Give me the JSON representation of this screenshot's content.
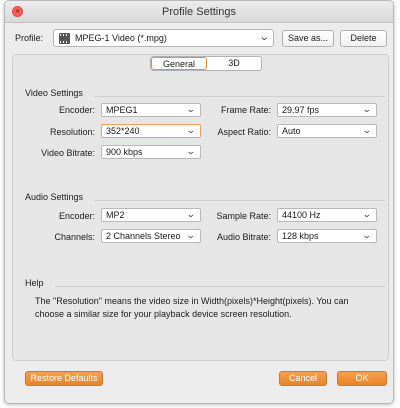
{
  "window": {
    "title": "Profile Settings"
  },
  "profile": {
    "label": "Profile:",
    "value": "MPEG-1 Video (*.mpg)",
    "save_as": "Save as...",
    "delete": "Delete"
  },
  "tabs": [
    "General",
    "3D"
  ],
  "video": {
    "title": "Video Settings",
    "encoder_label": "Encoder:",
    "encoder": "MPEG1",
    "resolution_label": "Resolution:",
    "resolution": "352*240",
    "bitrate_label": "Video Bitrate:",
    "bitrate": "900 kbps",
    "framerate_label": "Frame Rate:",
    "framerate": "29.97 fps",
    "aspect_label": "Aspect Ratio:",
    "aspect": "Auto"
  },
  "audio": {
    "title": "Audio Settings",
    "encoder_label": "Encoder:",
    "encoder": "MP2",
    "channels_label": "Channels:",
    "channels": "2 Channels Stereo",
    "samplerate_label": "Sample Rate:",
    "samplerate": "44100 Hz",
    "bitrate_label": "Audio Bitrate:",
    "bitrate": "128 kbps"
  },
  "help": {
    "title": "Help",
    "text": "The \"Resolution\" means the video size in Width(pixels)*Height(pixels).  You can choose a similar size for your playback device screen resolution."
  },
  "footer": {
    "restore": "Restore Defaults",
    "cancel": "Cancel",
    "ok": "OK"
  },
  "colors": {
    "accent": "#ef8a32",
    "close": "#fc605b"
  }
}
